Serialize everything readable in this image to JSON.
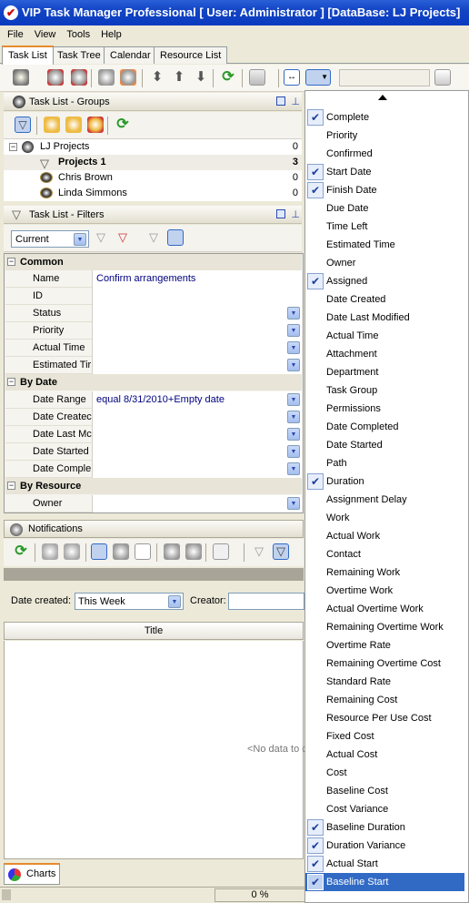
{
  "window": {
    "title": "VIP Task Manager Professional [ User: Administrator ] [DataBase: LJ Projects]"
  },
  "menubar": {
    "items": [
      "File",
      "View",
      "Tools",
      "Help"
    ]
  },
  "tabs": [
    "Task List",
    "Task Tree",
    "Calendar",
    "Resource List"
  ],
  "groups_panel": {
    "title": "Task List - Groups",
    "items": [
      {
        "label": "LJ Projects",
        "count": "0"
      },
      {
        "label": "Projects 1",
        "count": "3"
      },
      {
        "label": "Chris Brown",
        "count": "0"
      },
      {
        "label": "Linda Simmons",
        "count": "0"
      }
    ]
  },
  "filters_panel": {
    "title": "Task List - Filters",
    "current_filter": "Current",
    "groups": [
      {
        "name": "Common",
        "rows": [
          {
            "name": "Name",
            "value": "Confirm arrangements"
          },
          {
            "name": "ID",
            "value": ""
          },
          {
            "name": "Status",
            "value": ""
          },
          {
            "name": "Priority",
            "value": ""
          },
          {
            "name": "Actual Time",
            "value": ""
          },
          {
            "name": "Estimated Tir",
            "value": ""
          }
        ]
      },
      {
        "name": "By Date",
        "rows": [
          {
            "name": "Date Range",
            "value": "equal 8/31/2010+Empty date"
          },
          {
            "name": "Date Createc",
            "value": ""
          },
          {
            "name": "Date Last Mc",
            "value": ""
          },
          {
            "name": "Date Started",
            "value": ""
          },
          {
            "name": "Date Comple",
            "value": ""
          }
        ]
      },
      {
        "name": "By Resource",
        "rows": [
          {
            "name": "Owner",
            "value": ""
          }
        ]
      }
    ]
  },
  "notifications": {
    "title": "Notifications",
    "date_created_label": "Date created:",
    "date_created_value": "This Week",
    "creator_label": "Creator:",
    "column_title": "Title",
    "empty_text": "<No data to c"
  },
  "bottom_tab": "Charts",
  "status": {
    "progress": "0 %"
  },
  "column_menu": {
    "items": [
      {
        "label": "Complete",
        "checked": true
      },
      {
        "label": "Priority",
        "checked": false
      },
      {
        "label": "Confirmed",
        "checked": false
      },
      {
        "label": "Start Date",
        "checked": true
      },
      {
        "label": "Finish Date",
        "checked": true
      },
      {
        "label": "Due Date",
        "checked": false
      },
      {
        "label": "Time Left",
        "checked": false
      },
      {
        "label": "Estimated Time",
        "checked": false
      },
      {
        "label": "Owner",
        "checked": false
      },
      {
        "label": "Assigned",
        "checked": true
      },
      {
        "label": "Date Created",
        "checked": false
      },
      {
        "label": "Date Last Modified",
        "checked": false
      },
      {
        "label": "Actual Time",
        "checked": false
      },
      {
        "label": "Attachment",
        "checked": false
      },
      {
        "label": "Department",
        "checked": false
      },
      {
        "label": "Task Group",
        "checked": false
      },
      {
        "label": "Permissions",
        "checked": false
      },
      {
        "label": "Date Completed",
        "checked": false
      },
      {
        "label": "Date Started",
        "checked": false
      },
      {
        "label": "Path",
        "checked": false
      },
      {
        "label": "Duration",
        "checked": true
      },
      {
        "label": "Assignment Delay",
        "checked": false
      },
      {
        "label": "Work",
        "checked": false
      },
      {
        "label": "Actual Work",
        "checked": false
      },
      {
        "label": "Contact",
        "checked": false
      },
      {
        "label": "Remaining Work",
        "checked": false
      },
      {
        "label": "Overtime Work",
        "checked": false
      },
      {
        "label": "Actual Overtime Work",
        "checked": false
      },
      {
        "label": "Remaining Overtime Work",
        "checked": false
      },
      {
        "label": "Overtime Rate",
        "checked": false
      },
      {
        "label": "Remaining Overtime Cost",
        "checked": false
      },
      {
        "label": "Standard Rate",
        "checked": false
      },
      {
        "label": "Remaining Cost",
        "checked": false
      },
      {
        "label": "Resource Per Use Cost",
        "checked": false
      },
      {
        "label": "Fixed Cost",
        "checked": false
      },
      {
        "label": "Actual Cost",
        "checked": false
      },
      {
        "label": "Cost",
        "checked": false
      },
      {
        "label": "Baseline Cost",
        "checked": false
      },
      {
        "label": "Cost Variance",
        "checked": false
      },
      {
        "label": "Baseline Duration",
        "checked": true
      },
      {
        "label": "Duration Variance",
        "checked": true
      },
      {
        "label": "Actual Start",
        "checked": true
      },
      {
        "label": "Baseline Start",
        "checked": true,
        "highlighted": true
      }
    ]
  }
}
